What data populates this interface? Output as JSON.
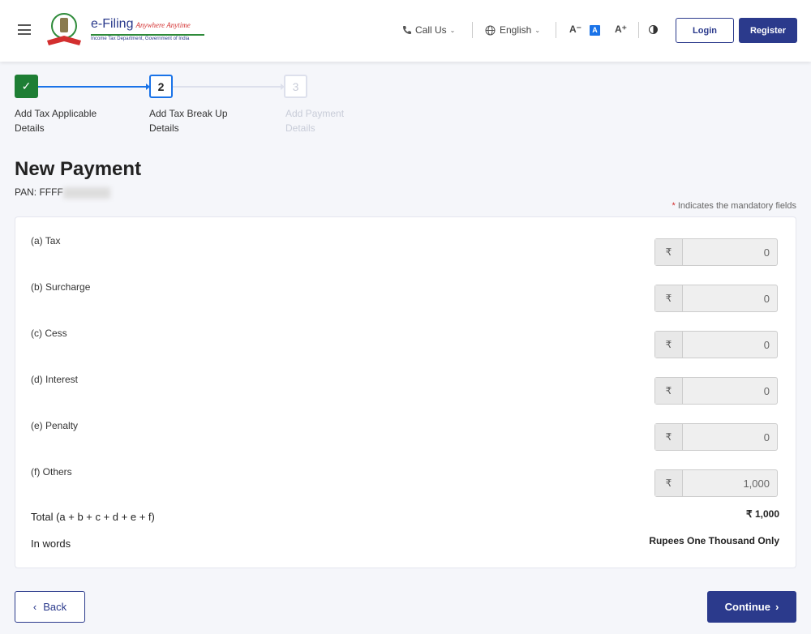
{
  "header": {
    "logo_title": "e-Filing",
    "logo_tagline": "Anywhere Anytime",
    "logo_subtitle": "Income Tax Department, Government of India",
    "call_us": "Call Us",
    "language": "English",
    "font_decrease": "A⁻",
    "font_normal": "A",
    "font_increase": "A⁺",
    "login": "Login",
    "register": "Register"
  },
  "stepper": {
    "steps": [
      {
        "number": "✓",
        "label": "Add Tax Applicable Details",
        "state": "completed"
      },
      {
        "number": "2",
        "label": "Add Tax Break Up Details",
        "state": "active"
      },
      {
        "number": "3",
        "label": "Add Payment Details",
        "state": "pending"
      }
    ]
  },
  "page": {
    "title": "New Payment",
    "pan_label": "PAN: FFFF",
    "mandatory_star": "*",
    "mandatory_note": "Indicates the mandatory fields"
  },
  "breakup": {
    "currency_symbol": "₹",
    "rows": [
      {
        "label": "(a) Tax",
        "value": "0"
      },
      {
        "label": "(b) Surcharge",
        "value": "0"
      },
      {
        "label": "(c) Cess",
        "value": "0"
      },
      {
        "label": "(d) Interest",
        "value": "0"
      },
      {
        "label": "(e) Penalty",
        "value": "0"
      },
      {
        "label": "(f) Others",
        "value": "1,000"
      }
    ],
    "total_label": "Total (a + b + c + d + e + f)",
    "total_value": "₹ 1,000",
    "words_label": "In words",
    "words_value": "Rupees One Thousand Only"
  },
  "footer": {
    "back": "Back",
    "continue": "Continue"
  },
  "colors": {
    "primary": "#2b3a8c",
    "active_step": "#1a73e8",
    "completed_step": "#1e7e34",
    "required": "#d32f2f"
  }
}
